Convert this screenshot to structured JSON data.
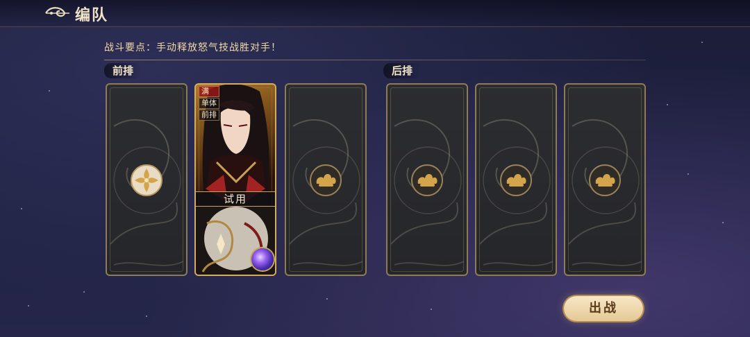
{
  "header": {
    "title": "编队",
    "back_icon": "swirl-back-icon"
  },
  "tip": "战斗要点：手动释放怒气技战胜对手！",
  "front_row": {
    "label": "前排"
  },
  "back_row": {
    "label": "后排"
  },
  "hero": {
    "tags": [
      "满",
      "单体",
      "前排"
    ],
    "trial_label": "试用"
  },
  "slots": {
    "front_1_icon": "gold-flower-emblem-icon",
    "lock_icon": "cloud-lock-icon"
  },
  "fight_button": {
    "label": "出战"
  },
  "colors": {
    "gold": "#d6ad5a",
    "panel": "#2a2b2e",
    "tip": "#f1d9a6"
  }
}
